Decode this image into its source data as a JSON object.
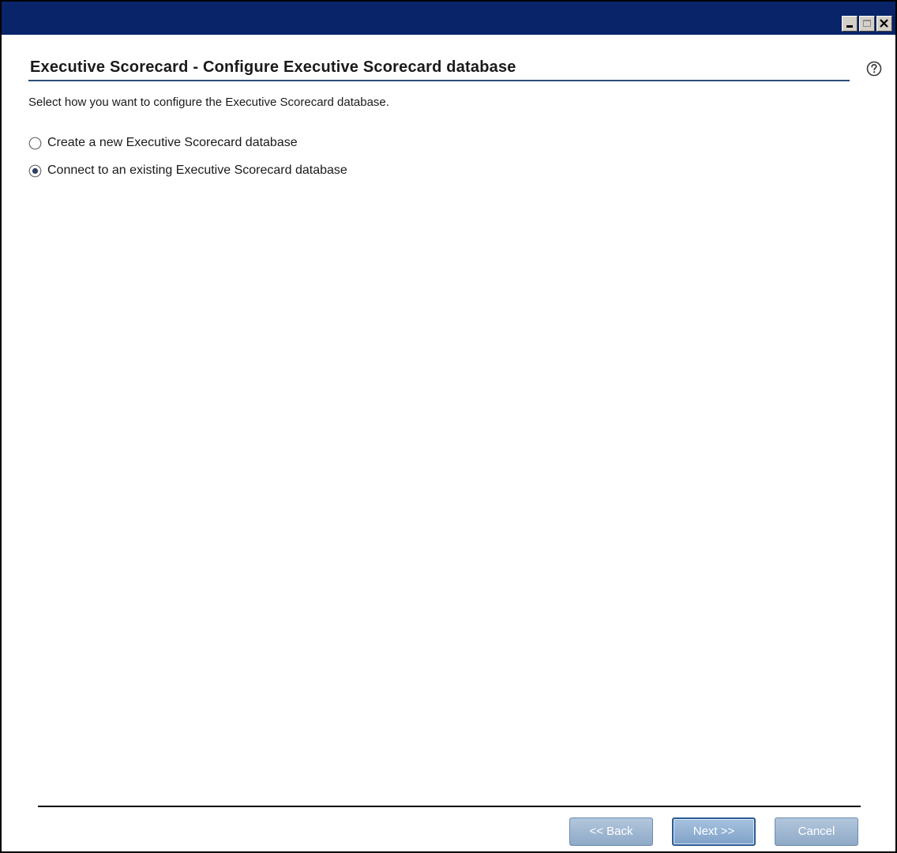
{
  "window": {
    "title": "",
    "controls": {
      "minimize": "minimize-icon",
      "maximize": "maximize-icon",
      "close": "close-icon"
    }
  },
  "page": {
    "title": "Executive Scorecard - Configure Executive Scorecard database",
    "instruction": "Select how you want to configure the Executive Scorecard database.",
    "help_icon": "help-icon"
  },
  "options": [
    {
      "label": "Create a new Executive Scorecard database",
      "selected": false
    },
    {
      "label": "Connect to an existing Executive Scorecard database",
      "selected": true
    }
  ],
  "buttons": {
    "back": "<< Back",
    "next": "Next >>",
    "cancel": "Cancel"
  },
  "colors": {
    "titlebar": "#0a246a",
    "title_rule": "#2a4e7a",
    "button": "#8ea9c7"
  }
}
